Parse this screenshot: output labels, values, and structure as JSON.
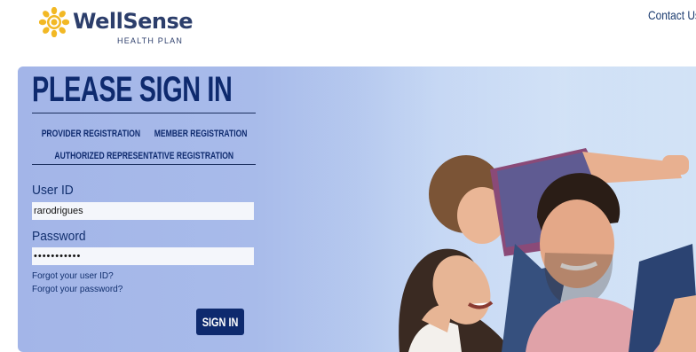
{
  "header": {
    "brand_name": "WellSense",
    "brand_tagline": "HEALTH PLAN",
    "contact_link": "Contact Us",
    "brand_color": "#2c3e6b",
    "logo_accent": "#f2b824"
  },
  "signin": {
    "title": "PLEASE SIGN IN",
    "registration_links": [
      "PROVIDER REGISTRATION",
      "MEMBER REGISTRATION",
      "AUTHORIZED REPRESENTATIVE REGISTRATION"
    ],
    "user_id_label": "User ID",
    "user_id_value": "rarodrigues",
    "password_label": "Password",
    "password_value": "•••••••••••",
    "forgot_user_id": "Forgot your user ID?",
    "forgot_password": "Forgot your password?",
    "submit_label": "SIGN IN",
    "accent_color": "#0e2a6e"
  }
}
